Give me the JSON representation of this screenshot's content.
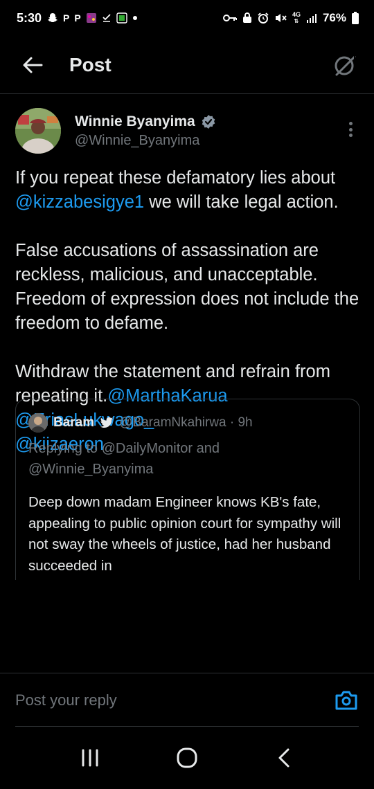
{
  "status_bar": {
    "time": "5:30",
    "left_icons": [
      "snapchat-icon",
      "p-icon",
      "p-icon",
      "app-icon",
      "check-icon",
      "app-icon",
      "dot-icon"
    ],
    "p_label": "P",
    "network": "4G",
    "battery": "76%"
  },
  "header": {
    "title": "Post"
  },
  "post": {
    "author_name": "Winnie Byanyima",
    "author_handle": "@Winnie_Byanyima",
    "verified": true,
    "p1_a": "If you repeat these defamatory lies about ",
    "p1_mention": "@kizzabesigye1",
    "p1_b": " we will take legal action.",
    "p2": "False accusations of assassination are reckless, malicious, and unacceptable. Freedom of expression does not include the freedom to defame.",
    "p3_a": "Withdraw the statement and refrain from repeating it.",
    "p3_mention1": "@MarthaKarua",
    "p3_mention2": "@EriasLukwago_",
    "p3_mention3": "@kiizaeron"
  },
  "quote": {
    "name": "Baram",
    "handle_time": "@BaramNkahirwa · 9h",
    "replying": "Replying to @DailyMonitor and @Winnie_Byanyima",
    "text": "Deep down madam Engineer knows KB's fate, appealing to public opinion court for sympathy will not sway the wheels of justice, had her husband succeeded in"
  },
  "reply": {
    "placeholder": "Post your reply"
  },
  "colors": {
    "accent": "#1d9bf0",
    "background": "#000000",
    "muted": "#71767b",
    "border": "#2f3336"
  }
}
